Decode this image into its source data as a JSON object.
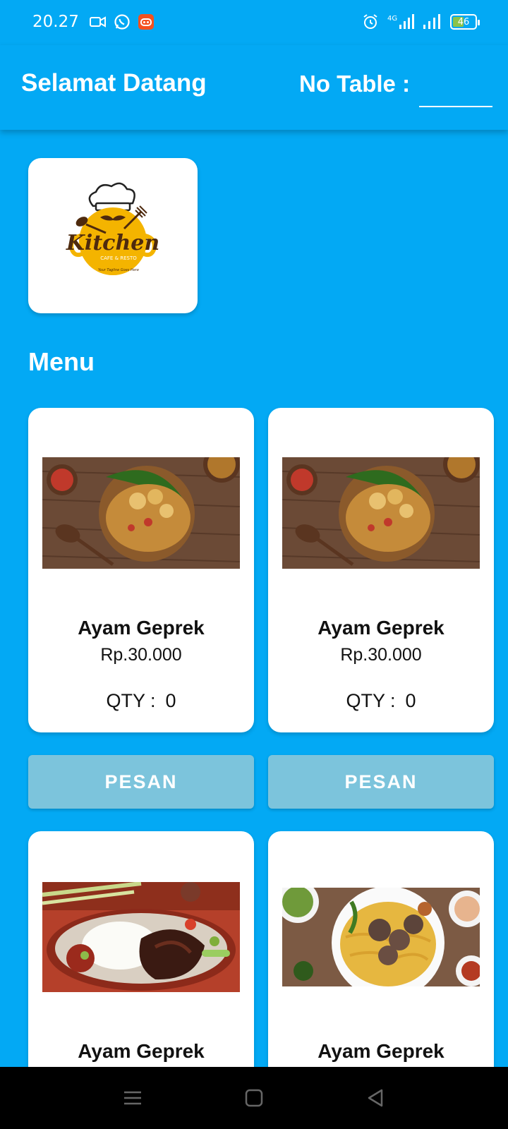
{
  "status_bar": {
    "time": "20.27",
    "battery_level": "46",
    "battery_fraction": 0.46,
    "network": "4G"
  },
  "header": {
    "welcome": "Selamat Datang",
    "table_label": "No Table :",
    "table_value": ""
  },
  "logo": {
    "brand_name": "Kitchen",
    "subtitle": "CAFE & RESTO",
    "tagline": "Your Tagline Goes Here"
  },
  "menu": {
    "heading": "Menu",
    "qty_label": "QTY :",
    "items": [
      {
        "name": "Ayam Geprek",
        "price": "Rp.30.000",
        "qty": "0",
        "button": "PESAN",
        "image": "nasi-goreng-photo"
      },
      {
        "name": "Ayam Geprek",
        "price": "Rp.30.000",
        "qty": "0",
        "button": "PESAN",
        "image": "nasi-goreng-photo"
      },
      {
        "name": "Ayam Geprek",
        "image": "ayam-bakar-photo"
      },
      {
        "name": "Ayam Geprek",
        "image": "mie-bakso-photo"
      }
    ]
  },
  "colors": {
    "primary": "#03A9F4",
    "card": "#FFFFFF",
    "button": "#7CC4DC",
    "logo_yellow": "#F4B400"
  },
  "nav": {
    "icons": [
      "menu-icon",
      "home-icon",
      "back-icon"
    ]
  }
}
